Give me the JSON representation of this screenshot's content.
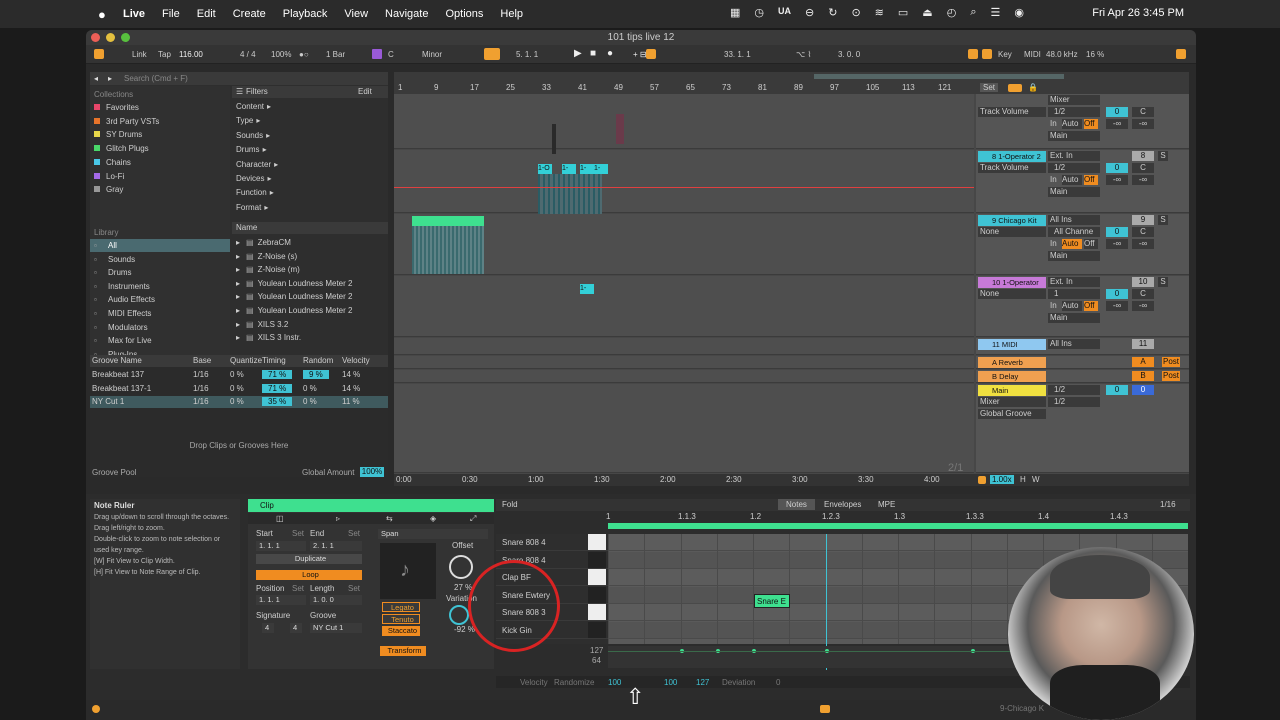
{
  "menubar": {
    "apple": "",
    "app": "Live",
    "items": [
      "File",
      "Edit",
      "Create",
      "Playback",
      "View",
      "Navigate",
      "Options",
      "Help"
    ],
    "clock": "Fri Apr 26  3:45 PM",
    "ua": "UA"
  },
  "window": {
    "title": "101 tips live 12"
  },
  "transport": {
    "link": "Link",
    "tap": "Tap",
    "tempo": "116.00",
    "sig": "4 / 4",
    "zoom": "100%",
    "quant": "1 Bar",
    "key": "C",
    "scale": "Minor",
    "pos": "5.  1.  1",
    "pos2": "33.  1.  1",
    "pos3": "3.  0.  0",
    "key_label": "Key",
    "midi": "MIDI",
    "rate": "48.0 kHz",
    "cpu": "16 %"
  },
  "browser": {
    "search": "Search (Cmd + F)",
    "collections_label": "Collections",
    "collections": [
      {
        "name": "Favorites",
        "color": "#e8466a"
      },
      {
        "name": "3rd Party VSTs",
        "color": "#e8742a"
      },
      {
        "name": "SY Drums",
        "color": "#e8d84a"
      },
      {
        "name": "Glitch Plugs",
        "color": "#4ad86a"
      },
      {
        "name": "Chains",
        "color": "#4ac8e8"
      },
      {
        "name": "Lo-Fi",
        "color": "#a46ae8"
      },
      {
        "name": "Gray",
        "color": "#999999"
      }
    ],
    "library_label": "Library",
    "library": [
      "All",
      "Sounds",
      "Drums",
      "Instruments",
      "Audio Effects",
      "MIDI Effects",
      "Modulators",
      "Max for Live",
      "Plug-Ins",
      "Clips"
    ],
    "filters": "Filters",
    "edit": "Edit",
    "filter_items": [
      "Content",
      "Type",
      "Sounds",
      "Drums",
      "Character",
      "Devices",
      "Function",
      "Format"
    ],
    "name_header": "Name",
    "files": [
      "ZebraCM",
      "Z-Noise (s)",
      "Z-Noise (m)",
      "Youlean Loudness Meter 2",
      "Youlean Loudness Meter 2",
      "Youlean Loudness Meter 2",
      "XILS 3.2",
      "XILS 3 Instr."
    ]
  },
  "groove": {
    "headers": [
      "Groove Name",
      "Base",
      "Quantize",
      "Timing",
      "Random",
      "Velocity"
    ],
    "rows": [
      [
        "Breakbeat 137",
        "1/16",
        "0 %",
        "71 %",
        "9 %",
        "14 %"
      ],
      [
        "Breakbeat 137-1",
        "1/16",
        "0 %",
        "71 %",
        "0 %",
        "14 %"
      ],
      [
        "NY Cut 1",
        "1/16",
        "0 %",
        "35 %",
        "0 %",
        "11 %"
      ]
    ],
    "drop": "Drop Clips or Grooves Here",
    "pool": "Groove Pool",
    "global": "Global Amount",
    "global_val": "100%"
  },
  "ruler": {
    "bars": [
      "1",
      "9",
      "17",
      "25",
      "33",
      "41",
      "49",
      "57",
      "65",
      "73",
      "81",
      "89",
      "97",
      "105",
      "113",
      "121"
    ],
    "times": [
      "0:00",
      "0:30",
      "1:00",
      "1:30",
      "2:00",
      "2:30",
      "3:00",
      "3:30",
      "4:00"
    ],
    "set": "Set",
    "page": "2/1"
  },
  "tracks": [
    {
      "name": "",
      "in": "Mixer",
      "ch": "1/2",
      "vol": "Track Volume",
      "out": "Main",
      "num": "",
      "color": "#555"
    },
    {
      "name": "8 1-Operator 2",
      "in": "Ext. In",
      "ch": "1/2",
      "vol": "Track Volume",
      "out": "Main",
      "num": "8",
      "color": "#3fc3d4"
    },
    {
      "name": "9 Chicago Kit",
      "in": "All Ins",
      "ch": "All Channe",
      "vol": "None",
      "out": "Main",
      "num": "9",
      "color": "#3fc3d4"
    },
    {
      "name": "10 1-Operator",
      "in": "Ext. In",
      "ch": "1",
      "vol": "None",
      "out": "Main",
      "num": "10",
      "color": "#c77ad8"
    },
    {
      "name": "11 MIDI",
      "in": "All Ins",
      "ch": "",
      "vol": "",
      "out": "",
      "num": "11",
      "color": "#8fc8f0"
    },
    {
      "name": "A Reverb",
      "num": "A",
      "color": "#f0a050"
    },
    {
      "name": "B Delay",
      "num": "B",
      "color": "#f0a050"
    },
    {
      "name": "Main",
      "ch": "1/2",
      "ch2": "1/2",
      "color": "#f0e040"
    }
  ],
  "mixer_labels": {
    "in": "In",
    "auto": "Auto",
    "off": "Off",
    "neginf": "-∞",
    "zero": "0",
    "c": "C",
    "s": "S",
    "post": "Post",
    "mixer": "Mixer",
    "global": "Global Groove",
    "scale": "1.00x",
    "h": "H",
    "w": "W"
  },
  "clips": {
    "c1": "1-O",
    "c2": "1-",
    "c3": "1-",
    "c4": "1-",
    "c5": "1-"
  },
  "noteruler": {
    "title": "Note Ruler",
    "lines": [
      "Drag up/down to scroll through the octaves.",
      "Drag left/right to zoom.",
      "Double-click to zoom to note selection or used key range.",
      "[W] Fit View to Clip Width.",
      "[H] Fit View to Note Range of Clip."
    ]
  },
  "clip": {
    "title": "Clip",
    "start": "Start",
    "end": "End",
    "set": "Set",
    "start_val": "1.   1.   1",
    "end_val": "2.   1.   1",
    "duplicate": "Duplicate",
    "loop": "Loop",
    "position": "Position",
    "length": "Length",
    "pos_val": "1.   1.   1",
    "len_val": "1.   0.   0",
    "signature": "Signature",
    "sig_num": "4",
    "sig_den": "4",
    "groove": "Groove",
    "groove_val": "NY Cut 1",
    "span": "Span",
    "offset": "Offset",
    "offset_val": "27 %",
    "variation": "Variation",
    "var_val": "-92 %",
    "legato": "Legato",
    "tenuto": "Tenuto",
    "staccato": "Staccato",
    "transform": "Transform"
  },
  "editor": {
    "fold": "Fold",
    "tabs": [
      "Notes",
      "Envelopes",
      "MPE"
    ],
    "grid": "1/16",
    "bars": [
      "1",
      "1.1.3",
      "1.2",
      "1.2.3",
      "1.3",
      "1.3.3",
      "1.4",
      "1.4.3"
    ],
    "notes": [
      "Snare 808 4",
      "Snare 808 4",
      "Clap BF",
      "Snare Ewtery",
      "Snare 808 3",
      "Kick Gin"
    ],
    "note_clip": "Snare E",
    "vel_hi": "127",
    "vel_lo": "64",
    "footer": [
      "Velocity",
      "Randomize",
      "100",
      "100",
      "127",
      "Deviation",
      "0"
    ]
  },
  "status": {
    "track": "9-Chicago K"
  }
}
